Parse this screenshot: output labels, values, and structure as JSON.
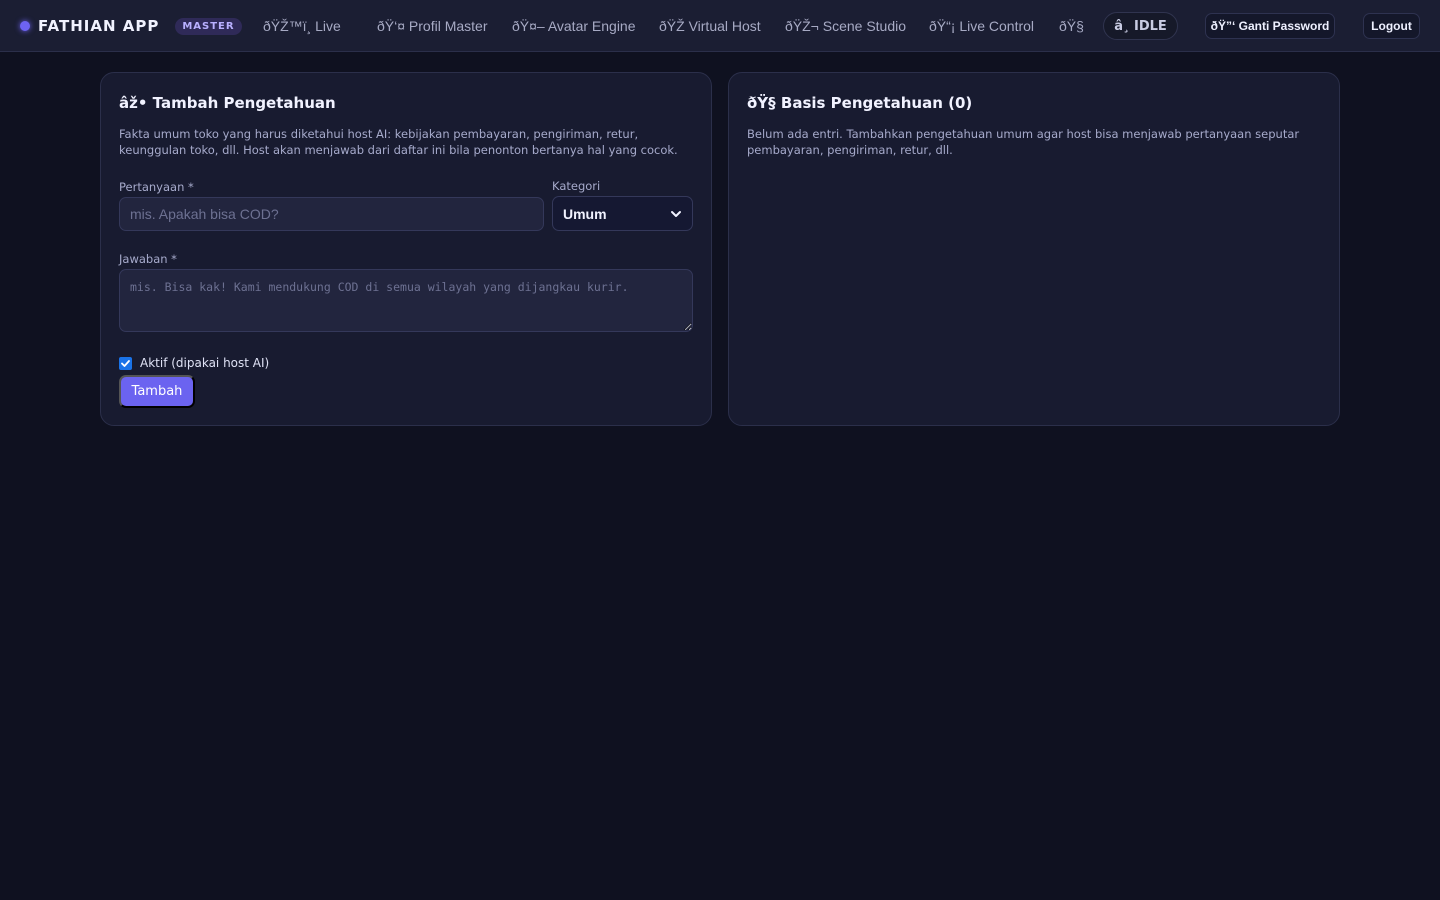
{
  "app": {
    "brand_name": "FATHIAN APP",
    "badge": "MASTER",
    "accent_color": "#6b63f0"
  },
  "nav": {
    "items": [
      {
        "label": "ðŸŽ™ï¸ Live"
      },
      {
        "label": "ðŸ‘¤ Profil Master"
      },
      {
        "label": "ðŸ¤– Avatar Engine"
      },
      {
        "label": "ðŸŽ Virtual Host"
      },
      {
        "label": "ðŸŽ¬ Scene Studio"
      },
      {
        "label": "ðŸ“¡ Live Control"
      },
      {
        "label": "ðŸ§"
      }
    ],
    "status": "â¸ IDLE",
    "change_password": "ðŸ”‘ Ganti Password",
    "logout": "Logout"
  },
  "add_card": {
    "title": "âž• Tambah Pengetahuan",
    "description": "Fakta umum toko yang harus diketahui host AI: kebijakan pembayaran, pengiriman, retur, keunggulan toko, dll. Host akan menjawab dari daftar ini bila penonton bertanya hal yang cocok.",
    "question_label": "Pertanyaan *",
    "question_placeholder": "mis. Apakah bisa COD?",
    "question_value": "",
    "category_label": "Kategori",
    "category_selected": "Umum",
    "answer_label": "Jawaban *",
    "answer_placeholder": "mis. Bisa kak! Kami mendukung COD di semua wilayah yang dijangkau kurir.",
    "answer_value": "",
    "active_label": "Aktif (dipakai host AI)",
    "active_checked": true,
    "submit_label": "Tambah"
  },
  "list_card": {
    "title": "ðŸ§  Basis Pengetahuan (0)",
    "empty_text": "Belum ada entri. Tambahkan pengetahuan umum agar host bisa menjawab pertanyaan seputar pembayaran, pengiriman, retur, dll."
  }
}
